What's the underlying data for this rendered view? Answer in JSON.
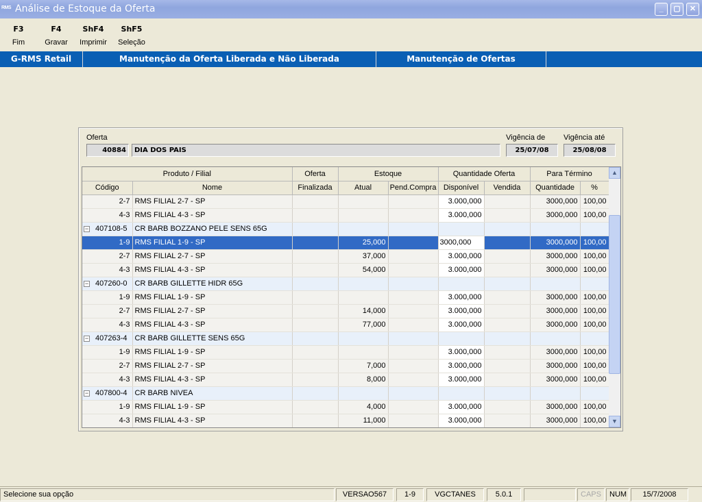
{
  "window": {
    "app_icon": "RMS",
    "title": "Análise de Estoque da Oferta",
    "buttons": [
      "_",
      "▢",
      "✕"
    ]
  },
  "toolbar": [
    {
      "key": "F3",
      "label": "Fim"
    },
    {
      "key": "F4",
      "label": "Gravar"
    },
    {
      "key": "ShF4",
      "label": "Imprimir"
    },
    {
      "key": "ShF5",
      "label": "Seleção"
    }
  ],
  "band": {
    "tab1": "G-RMS Retail",
    "tab2": "Manutenção da Oferta Liberada e Não Liberada",
    "tab3": "Manutenção de Ofertas"
  },
  "offer": {
    "label": "Oferta",
    "code": "40884",
    "name": "DIA DOS PAIS",
    "vig_de_label": "Vigência de",
    "vig_de": "25/07/08",
    "vig_ate_label": "Vigência até",
    "vig_ate": "25/08/08"
  },
  "grid": {
    "header_groups": [
      "Produto / Filial",
      "Oferta",
      "Estoque",
      "Quantidade Oferta",
      "Para Término"
    ],
    "columns": [
      "Código",
      "Nome",
      "Finalizada",
      "Atual",
      "Pend.Compra",
      "Disponível",
      "Vendida",
      "Quantidade",
      "%"
    ],
    "rows": [
      {
        "type": "sub",
        "code": "2-7",
        "name": "RMS FILIAL 2-7 - SP",
        "fin": "",
        "atual": "",
        "pend": "",
        "disp": "3.000,000",
        "vend": "",
        "qtd": "3000,000",
        "pct": "100,00"
      },
      {
        "type": "sub",
        "code": "4-3",
        "name": "RMS FILIAL 4-3 - SP",
        "fin": "",
        "atual": "",
        "pend": "",
        "disp": "3.000,000",
        "vend": "",
        "qtd": "3000,000",
        "pct": "100,00"
      },
      {
        "type": "grp",
        "code": "407108-5",
        "name": "CR BARB BOZZANO PELE SENS 65G"
      },
      {
        "type": "sel",
        "code": "1-9",
        "name": "RMS FILIAL 1-9 - SP",
        "fin": "",
        "atual": "25,000",
        "pend": "",
        "disp": "3000,000",
        "vend": "",
        "qtd": "3000,000",
        "pct": "100,00"
      },
      {
        "type": "sub",
        "code": "2-7",
        "name": "RMS FILIAL 2-7 - SP",
        "fin": "",
        "atual": "37,000",
        "pend": "",
        "disp": "3.000,000",
        "vend": "",
        "qtd": "3000,000",
        "pct": "100,00"
      },
      {
        "type": "sub",
        "code": "4-3",
        "name": "RMS FILIAL 4-3 - SP",
        "fin": "",
        "atual": "54,000",
        "pend": "",
        "disp": "3.000,000",
        "vend": "",
        "qtd": "3000,000",
        "pct": "100,00"
      },
      {
        "type": "grp",
        "code": "407260-0",
        "name": "CR BARB GILLETTE HIDR 65G"
      },
      {
        "type": "sub",
        "code": "1-9",
        "name": "RMS FILIAL 1-9 - SP",
        "fin": "",
        "atual": "",
        "pend": "",
        "disp": "3.000,000",
        "vend": "",
        "qtd": "3000,000",
        "pct": "100,00"
      },
      {
        "type": "sub",
        "code": "2-7",
        "name": "RMS FILIAL 2-7 - SP",
        "fin": "",
        "atual": "14,000",
        "pend": "",
        "disp": "3.000,000",
        "vend": "",
        "qtd": "3000,000",
        "pct": "100,00"
      },
      {
        "type": "sub",
        "code": "4-3",
        "name": "RMS FILIAL 4-3 - SP",
        "fin": "",
        "atual": "77,000",
        "pend": "",
        "disp": "3.000,000",
        "vend": "",
        "qtd": "3000,000",
        "pct": "100,00"
      },
      {
        "type": "grp",
        "code": "407263-4",
        "name": "CR BARB GILLETTE SENS 65G"
      },
      {
        "type": "sub",
        "code": "1-9",
        "name": "RMS FILIAL 1-9 - SP",
        "fin": "",
        "atual": "",
        "pend": "",
        "disp": "3.000,000",
        "vend": "",
        "qtd": "3000,000",
        "pct": "100,00"
      },
      {
        "type": "sub",
        "code": "2-7",
        "name": "RMS FILIAL 2-7 - SP",
        "fin": "",
        "atual": "7,000",
        "pend": "",
        "disp": "3.000,000",
        "vend": "",
        "qtd": "3000,000",
        "pct": "100,00"
      },
      {
        "type": "sub",
        "code": "4-3",
        "name": "RMS FILIAL 4-3 - SP",
        "fin": "",
        "atual": "8,000",
        "pend": "",
        "disp": "3.000,000",
        "vend": "",
        "qtd": "3000,000",
        "pct": "100,00"
      },
      {
        "type": "grp",
        "code": "407800-4",
        "name": "CR BARB NIVEA"
      },
      {
        "type": "sub",
        "code": "1-9",
        "name": "RMS FILIAL 1-9 - SP",
        "fin": "",
        "atual": "4,000",
        "pend": "",
        "disp": "3.000,000",
        "vend": "",
        "qtd": "3000,000",
        "pct": "100,00"
      },
      {
        "type": "sub",
        "code": "4-3",
        "name": "RMS FILIAL 4-3 - SP",
        "fin": "",
        "atual": "11,000",
        "pend": "",
        "disp": "3.000,000",
        "vend": "",
        "qtd": "3000,000",
        "pct": "100,00"
      }
    ]
  },
  "status": {
    "message": "Selecione sua opção",
    "version": "VERSAO567",
    "filial": "1-9",
    "user": "VGCTANES",
    "release": "5.0.1",
    "blank": "",
    "caps": "CAPS",
    "num": "NUM",
    "date": "15/7/2008"
  }
}
